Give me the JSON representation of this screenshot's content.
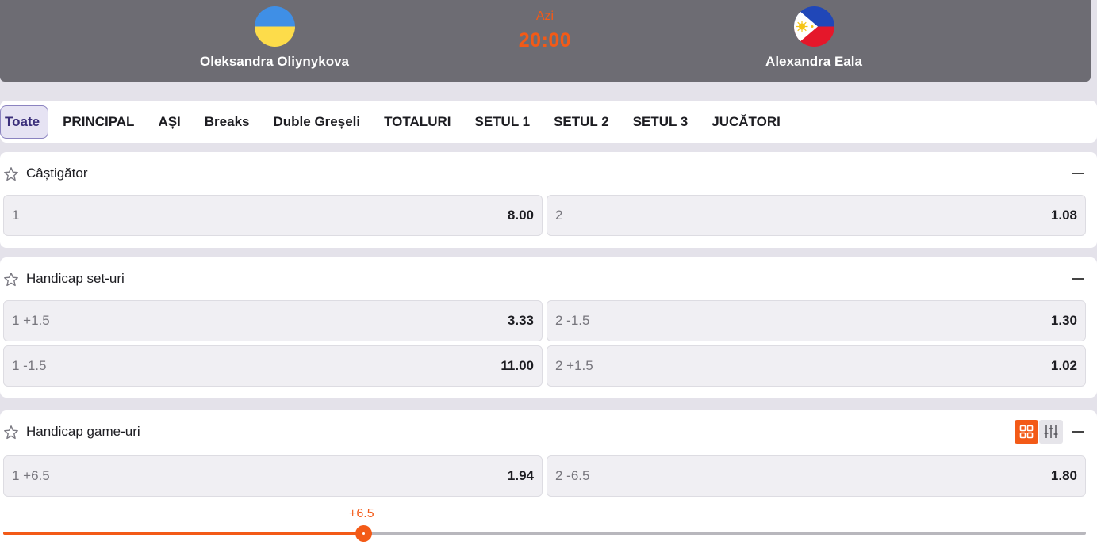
{
  "match": {
    "home": {
      "name": "Oleksandra Oliynykova",
      "flag": "ukraine-flag-icon"
    },
    "away": {
      "name": "Alexandra Eala",
      "flag": "philippines-flag-icon"
    },
    "day": "Azi",
    "time": "20:00"
  },
  "tabs": [
    {
      "label": "Toate",
      "active": true
    },
    {
      "label": "PRINCIPAL"
    },
    {
      "label": "AȘI"
    },
    {
      "label": "Breaks"
    },
    {
      "label": "Duble Greșeli"
    },
    {
      "label": "TOTALURI"
    },
    {
      "label": "SETUL 1"
    },
    {
      "label": "SETUL 2"
    },
    {
      "label": "SETUL 3"
    },
    {
      "label": "JUCĂTORI"
    }
  ],
  "markets": [
    {
      "title": "Câștigător",
      "odds": [
        {
          "label": "1",
          "value": "8.00"
        },
        {
          "label": "2",
          "value": "1.08"
        }
      ]
    },
    {
      "title": "Handicap set-uri",
      "odds": [
        {
          "label": "1 +1.5",
          "value": "3.33"
        },
        {
          "label": "2 -1.5",
          "value": "1.30"
        },
        {
          "label": "1 -1.5",
          "value": "11.00"
        },
        {
          "label": "2 +1.5",
          "value": "1.02"
        }
      ]
    },
    {
      "title": "Handicap game-uri",
      "odds": [
        {
          "label": "1 +6.5",
          "value": "1.94"
        },
        {
          "label": "2 -6.5",
          "value": "1.80"
        }
      ],
      "slider": {
        "value_label": "+6.5",
        "position_fraction": 0.333
      }
    }
  ],
  "colors": {
    "accent": "#f35a17",
    "header": "#6d6c73",
    "active_tab": "#3a2e7a"
  }
}
